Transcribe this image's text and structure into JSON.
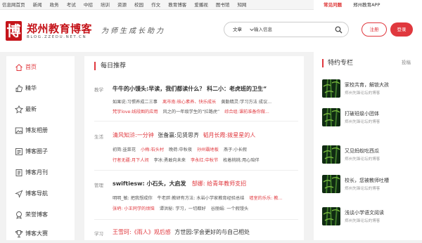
{
  "topnav": {
    "items": [
      "信息网首页",
      "新闻",
      "政务",
      "考试",
      "中招",
      "培训",
      "资源",
      "校园",
      "作文",
      "教育博客",
      "爱播视",
      "图书馆",
      "知网"
    ],
    "help": "常见问题",
    "app": "郑州教育APP"
  },
  "header": {
    "logo_char": "博",
    "logo_title": "郑州教育博客",
    "logo_sub": "BLOG.ZZEDU.NET.CN",
    "slogan": "为师生成长助力",
    "search_type": "文章",
    "search_placeholder": "输入信息",
    "register": "注册",
    "login": "登录",
    "accent": "#e0383e"
  },
  "sidebar": {
    "items": [
      {
        "label": "首页",
        "icon": "home-icon"
      },
      {
        "label": "精华",
        "icon": "thumbs-up-icon"
      },
      {
        "label": "最新",
        "icon": "new-icon"
      },
      {
        "label": "博友相册",
        "icon": "album-icon"
      },
      {
        "label": "博客圈子",
        "icon": "circle-icon"
      },
      {
        "label": "博客月刊",
        "icon": "monthly-icon"
      },
      {
        "label": "博客导航",
        "icon": "navigation-icon"
      },
      {
        "label": "荣誉博客",
        "icon": "honor-icon"
      },
      {
        "label": "博客大赛",
        "icon": "trophy-icon"
      }
    ]
  },
  "main": {
    "section_title": "每日推荐",
    "posts": [
      {
        "cat": "教学",
        "title": "牛牛的小馒头:早读，我们都读什么？  科二小：老虎班的卫生“",
        "line1": [
          {
            "t": "如果说:习惯养成二三事",
            "r": false
          },
          {
            "t": "离市南:核心素养、快乐成长",
            "r": true
          },
          {
            "t": "黄勤精灵:学习方法 成议...",
            "r": false
          }
        ],
        "line2": [
          {
            "t": "梵宇love:线段图的应用",
            "r": true
          },
          {
            "t": "风之的一年级学生的“拉路虎”",
            "r": false
          },
          {
            "t": "综合组:课前准备你做...",
            "r": true
          }
        ]
      },
      {
        "cat": "生活",
        "title": "清风知浒:一分钟",
        "title2": "张备赢:见贤思齐",
        "title3": "韬月长霞:拨星星的人",
        "line1": [
          {
            "t": "初简:韭菜花",
            "r": false
          },
          {
            "t": "小梅:石头村",
            "r": true
          },
          {
            "t": "晚荷:中秋夜",
            "r": false
          },
          {
            "t": "孙州霸地板",
            "r": true
          },
          {
            "t": "燕子:小长假",
            "r": false
          }
        ],
        "line2": [
          {
            "t": "行者无疆:月下人间",
            "r": true
          },
          {
            "t": "李冰:勇敢向未来",
            "r": false
          },
          {
            "t": "李永红:中秋节",
            "r": true
          },
          {
            "t": "枚着桃桃:用心陪伴",
            "r": false
          }
        ]
      },
      {
        "cat": "管理",
        "title": "swiftiesw:  小石头，大启发",
        "title2": "郜娜:  给青年教师支招",
        "line1": [
          {
            "t": "明明_敏: 把我想成你",
            "r": false
          },
          {
            "t": "牛老胖:教研有方法: 水岩小学家教育经验总结",
            "r": false
          },
          {
            "t": "墙室的乐乐: 教...",
            "r": true
          }
        ],
        "line2": [
          {
            "t": "张坍: 小王同学的烦恼",
            "r": true
          },
          {
            "t": "谭洪秘: 学习，一切都好",
            "r": false
          },
          {
            "t": "谷丽娟: 一个假馒头",
            "r": false
          }
        ]
      },
      {
        "cat": "学习",
        "title": "王雪珂:《雨人》观后感",
        "title2": "方世园:学会更好的与自己相处"
      }
    ]
  },
  "right": {
    "title": "特约专栏",
    "more": "投稿",
    "cards": [
      {
        "title": "家校共育，解锁大孩",
        "sub": "郑州先锋论坛的博客"
      },
      {
        "title": "打破班级小团体",
        "sub": "郑州先锋论坛的博客"
      },
      {
        "title": "又见蚂蚁吃西瓜",
        "sub": "郑州先锋论坛的博客"
      },
      {
        "title": "校长，您被教师吐槽",
        "sub": "郑州先锋论坛的博客"
      },
      {
        "title": "浅谈小学语文阅读",
        "sub": "郑州先锋论坛的博客"
      }
    ]
  }
}
